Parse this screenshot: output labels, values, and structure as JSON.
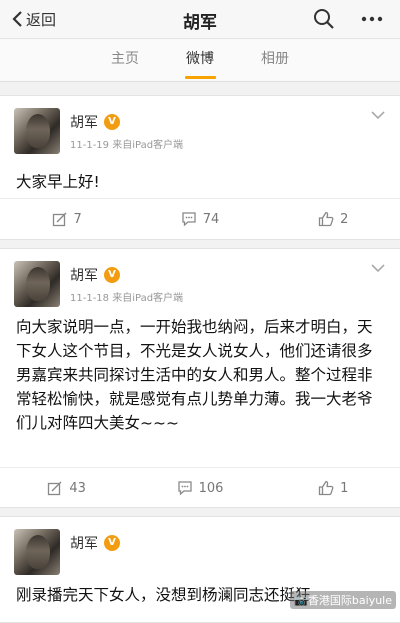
{
  "header": {
    "back_label": "返回",
    "title": "胡军",
    "search_icon": "search-icon",
    "more_icon": "more-icon"
  },
  "tabs": [
    {
      "label": "主页",
      "active": false
    },
    {
      "label": "微博",
      "active": true
    },
    {
      "label": "相册",
      "active": false
    }
  ],
  "posts": [
    {
      "author": "胡军",
      "meta": "11-1-19 来自iPad客户端",
      "content": "大家早上好!",
      "reposts": "7",
      "comments": "74",
      "likes": "2"
    },
    {
      "author": "胡军",
      "meta": "11-1-18 来自iPad客户端",
      "content": "向大家说明一点，一开始我也纳闷，后来才明白，天下女人这个节目，不光是女人说女人，他们还请很多男嘉宾来共同探讨生活中的女人和男人。整个过程非常轻松愉快，就是感觉有点儿势单力薄。我一大老爷们儿对阵四大美女~~~",
      "reposts": "43",
      "comments": "106",
      "likes": "1"
    },
    {
      "author": "胡军",
      "meta": "",
      "content": "刚录播完天下女人，没想到杨澜同志还挺狂",
      "reposts": "",
      "comments": "",
      "likes": ""
    }
  ],
  "watermark": "📷香港国际baiyule",
  "colors": {
    "accent": "#f7a300",
    "badge": "#f39c12",
    "background": "#f2f2f2"
  }
}
